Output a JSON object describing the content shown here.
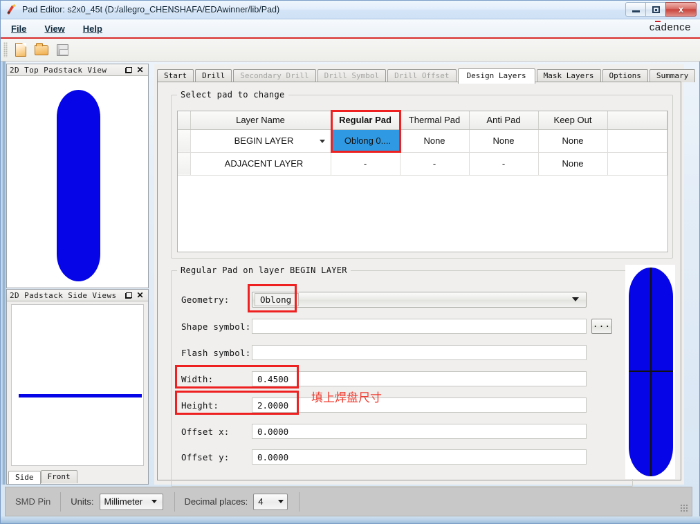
{
  "window": {
    "title": "Pad Editor: s2x0_45t  (D:/allegro_CHENSHAFA/EDAwinner/lib/Pad)",
    "app_icon": "pad-editor-icon",
    "minimize": "–",
    "maximize": "□",
    "close": "x"
  },
  "menubar": {
    "items": [
      {
        "label": "File"
      },
      {
        "label": "View"
      },
      {
        "label": "Help"
      }
    ],
    "brand": {
      "pre": "c",
      "a": "a",
      "post": "dence"
    }
  },
  "toolbar": {
    "buttons": [
      {
        "name": "new-file-button",
        "icon": "new-file-icon"
      },
      {
        "name": "open-file-button",
        "icon": "open-folder-icon"
      },
      {
        "name": "save-file-button",
        "icon": "save-disk-icon"
      }
    ]
  },
  "panels": {
    "top_view": {
      "title": "2D Top Padstack View",
      "float_icon": "restore-icon",
      "close_icon": "close-icon"
    },
    "side_view": {
      "title": "2D Padstack Side Views",
      "float_icon": "restore-icon",
      "close_icon": "close-icon",
      "tabs": [
        {
          "label": "Side",
          "active": true
        },
        {
          "label": "Front",
          "active": false
        }
      ]
    }
  },
  "tabs": [
    {
      "label": "Start",
      "state": "enabled"
    },
    {
      "label": "Drill",
      "state": "enabled"
    },
    {
      "label": "Secondary Drill",
      "state": "disabled"
    },
    {
      "label": "Drill Symbol",
      "state": "disabled"
    },
    {
      "label": "Drill Offset",
      "state": "disabled"
    },
    {
      "label": "Design Layers",
      "state": "active"
    },
    {
      "label": "Mask Layers",
      "state": "enabled"
    },
    {
      "label": "Options",
      "state": "enabled"
    },
    {
      "label": "Summary",
      "state": "enabled"
    }
  ],
  "select_pad_group": {
    "legend": "Select pad to change",
    "columns": [
      "Layer Name",
      "Regular Pad",
      "Thermal Pad",
      "Anti Pad",
      "Keep Out"
    ],
    "highlighted_column": "Regular Pad",
    "rows": [
      {
        "layer_name": "BEGIN LAYER",
        "has_dropdown": true,
        "dimmed": false,
        "regular_pad": "Oblong 0....",
        "regular_pad_selected": true,
        "thermal_pad": "None",
        "anti_pad": "None",
        "keep_out": "None"
      },
      {
        "layer_name": "ADJACENT LAYER",
        "has_dropdown": false,
        "dimmed": true,
        "regular_pad": "-",
        "regular_pad_selected": false,
        "thermal_pad": "-",
        "anti_pad": "-",
        "keep_out": "None"
      }
    ]
  },
  "regular_pad_group": {
    "legend": "Regular Pad on layer BEGIN LAYER",
    "fields": [
      {
        "label": "Geometry:",
        "value": "Oblong",
        "type": "combo",
        "highlighted": true
      },
      {
        "label": "Shape symbol:",
        "value": "",
        "type": "text-with-browse",
        "browse_label": "..."
      },
      {
        "label": "Flash symbol:",
        "value": "",
        "type": "text"
      },
      {
        "label": "Width:",
        "value": "0.4500",
        "type": "number",
        "highlighted": true
      },
      {
        "label": "Height:",
        "value": "2.0000",
        "type": "number",
        "highlighted": true
      },
      {
        "label": "Offset x:",
        "value": "0.0000",
        "type": "number"
      },
      {
        "label": "Offset y:",
        "value": "0.0000",
        "type": "number"
      }
    ]
  },
  "annotation": {
    "text": "填上焊盘尺寸",
    "color": "#f03a2e"
  },
  "statusbar": {
    "pad_type": "SMD Pin",
    "units_label": "Units:",
    "units_value": "Millimeter",
    "decimal_label": "Decimal places:",
    "decimal_value": "4",
    "resize_grip": "resize-grip-icon"
  },
  "colors": {
    "pad_blue": "#0505e8",
    "selection_blue": "#2f9ae3",
    "annotation_red": "#ee2020",
    "cadence_red": "#cf1b24"
  }
}
